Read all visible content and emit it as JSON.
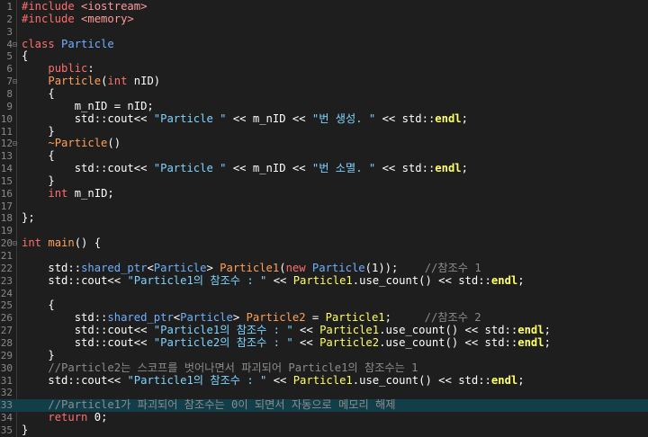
{
  "lines": [
    {
      "n": "1",
      "fold": "",
      "cls": "",
      "tokens": [
        {
          "c": "t-pre",
          "t": "#include "
        },
        {
          "c": "t-inc",
          "t": "<iostream>"
        }
      ]
    },
    {
      "n": "2",
      "fold": "",
      "cls": "",
      "tokens": [
        {
          "c": "t-pre",
          "t": "#include "
        },
        {
          "c": "t-inc",
          "t": "<memory>"
        }
      ]
    },
    {
      "n": "3",
      "fold": "",
      "cls": "",
      "tokens": []
    },
    {
      "n": "4",
      "fold": "⊟",
      "cls": "",
      "tokens": [
        {
          "c": "t-kw",
          "t": "class "
        },
        {
          "c": "t-type",
          "t": "Particle"
        }
      ]
    },
    {
      "n": "5",
      "fold": "",
      "cls": "",
      "tokens": [
        {
          "c": "t-op",
          "t": "{"
        }
      ]
    },
    {
      "n": "6",
      "fold": "",
      "cls": "",
      "tokens": [
        {
          "c": "t-op",
          "t": "    "
        },
        {
          "c": "t-kw",
          "t": "public"
        },
        {
          "c": "t-op",
          "t": ":"
        }
      ]
    },
    {
      "n": "7",
      "fold": "⊟",
      "cls": "",
      "tokens": [
        {
          "c": "t-op",
          "t": "    "
        },
        {
          "c": "t-fn",
          "t": "Particle"
        },
        {
          "c": "t-op",
          "t": "("
        },
        {
          "c": "t-kw",
          "t": "int "
        },
        {
          "c": "t-var",
          "t": "nID"
        },
        {
          "c": "t-op",
          "t": ")"
        }
      ]
    },
    {
      "n": "8",
      "fold": "",
      "cls": "",
      "tokens": [
        {
          "c": "t-op",
          "t": "    {"
        }
      ]
    },
    {
      "n": "9",
      "fold": "",
      "cls": "",
      "tokens": [
        {
          "c": "t-op",
          "t": "        "
        },
        {
          "c": "t-var",
          "t": "m_nID"
        },
        {
          "c": "t-op",
          "t": " = "
        },
        {
          "c": "t-var",
          "t": "nID"
        },
        {
          "c": "t-op",
          "t": ";"
        }
      ]
    },
    {
      "n": "10",
      "fold": "",
      "cls": "",
      "tokens": [
        {
          "c": "t-op",
          "t": "        "
        },
        {
          "c": "t-var",
          "t": "std"
        },
        {
          "c": "t-op",
          "t": "::"
        },
        {
          "c": "t-var",
          "t": "cout"
        },
        {
          "c": "t-op",
          "t": "<< "
        },
        {
          "c": "t-str",
          "t": "\"Particle \""
        },
        {
          "c": "t-op",
          "t": " << "
        },
        {
          "c": "t-var",
          "t": "m_nID"
        },
        {
          "c": "t-op",
          "t": " << "
        },
        {
          "c": "t-str",
          "t": "\"번 생성. \""
        },
        {
          "c": "t-op",
          "t": " << "
        },
        {
          "c": "t-var",
          "t": "std"
        },
        {
          "c": "t-op",
          "t": "::"
        },
        {
          "c": "t-endl",
          "t": "endl"
        },
        {
          "c": "t-op",
          "t": ";"
        }
      ]
    },
    {
      "n": "11",
      "fold": "",
      "cls": "",
      "tokens": [
        {
          "c": "t-op",
          "t": "    }"
        }
      ]
    },
    {
      "n": "12",
      "fold": "⊟",
      "cls": "",
      "tokens": [
        {
          "c": "t-op",
          "t": "    "
        },
        {
          "c": "t-fn",
          "t": "~Particle"
        },
        {
          "c": "t-op",
          "t": "()"
        }
      ]
    },
    {
      "n": "13",
      "fold": "",
      "cls": "",
      "tokens": [
        {
          "c": "t-op",
          "t": "    {"
        }
      ]
    },
    {
      "n": "14",
      "fold": "",
      "cls": "",
      "tokens": [
        {
          "c": "t-op",
          "t": "        "
        },
        {
          "c": "t-var",
          "t": "std"
        },
        {
          "c": "t-op",
          "t": "::"
        },
        {
          "c": "t-var",
          "t": "cout"
        },
        {
          "c": "t-op",
          "t": "<< "
        },
        {
          "c": "t-str",
          "t": "\"Particle \""
        },
        {
          "c": "t-op",
          "t": " << "
        },
        {
          "c": "t-var",
          "t": "m_nID"
        },
        {
          "c": "t-op",
          "t": " << "
        },
        {
          "c": "t-str",
          "t": "\"번 소멸. \""
        },
        {
          "c": "t-op",
          "t": " << "
        },
        {
          "c": "t-var",
          "t": "std"
        },
        {
          "c": "t-op",
          "t": "::"
        },
        {
          "c": "t-endl",
          "t": "endl"
        },
        {
          "c": "t-op",
          "t": ";"
        }
      ]
    },
    {
      "n": "15",
      "fold": "",
      "cls": "",
      "tokens": [
        {
          "c": "t-op",
          "t": "    }"
        }
      ]
    },
    {
      "n": "16",
      "fold": "",
      "cls": "",
      "tokens": [
        {
          "c": "t-op",
          "t": "    "
        },
        {
          "c": "t-kw",
          "t": "int "
        },
        {
          "c": "t-var",
          "t": "m_nID"
        },
        {
          "c": "t-op",
          "t": ";"
        }
      ]
    },
    {
      "n": "17",
      "fold": "",
      "cls": "",
      "tokens": []
    },
    {
      "n": "18",
      "fold": "",
      "cls": "",
      "tokens": [
        {
          "c": "t-op",
          "t": "};"
        }
      ]
    },
    {
      "n": "19",
      "fold": "",
      "cls": "",
      "tokens": []
    },
    {
      "n": "20",
      "fold": "⊟",
      "cls": "",
      "tokens": [
        {
          "c": "t-kw",
          "t": "int "
        },
        {
          "c": "t-fn",
          "t": "main"
        },
        {
          "c": "t-op",
          "t": "() {"
        }
      ]
    },
    {
      "n": "21",
      "fold": "",
      "cls": "",
      "tokens": []
    },
    {
      "n": "22",
      "fold": "",
      "cls": "",
      "tokens": [
        {
          "c": "t-op",
          "t": "    "
        },
        {
          "c": "t-var",
          "t": "std"
        },
        {
          "c": "t-op",
          "t": "::"
        },
        {
          "c": "t-ns",
          "t": "shared_ptr"
        },
        {
          "c": "t-op",
          "t": "<"
        },
        {
          "c": "t-type",
          "t": "Particle"
        },
        {
          "c": "t-op",
          "t": "> "
        },
        {
          "c": "t-fn",
          "t": "Particle1"
        },
        {
          "c": "t-op",
          "t": "("
        },
        {
          "c": "t-kw",
          "t": "new "
        },
        {
          "c": "t-type",
          "t": "Particle"
        },
        {
          "c": "t-op",
          "t": "("
        },
        {
          "c": "t-num",
          "t": "1"
        },
        {
          "c": "t-op",
          "t": "));    "
        },
        {
          "c": "t-cmt",
          "t": "//참조수 1"
        }
      ]
    },
    {
      "n": "23",
      "fold": "",
      "cls": "",
      "tokens": [
        {
          "c": "t-op",
          "t": "    "
        },
        {
          "c": "t-var",
          "t": "std"
        },
        {
          "c": "t-op",
          "t": "::"
        },
        {
          "c": "t-var",
          "t": "cout"
        },
        {
          "c": "t-op",
          "t": "<< "
        },
        {
          "c": "t-str",
          "t": "\"Particle1의 참조수 : \""
        },
        {
          "c": "t-op",
          "t": " << "
        },
        {
          "c": "t-mem",
          "t": "Particle1"
        },
        {
          "c": "t-op",
          "t": "."
        },
        {
          "c": "t-var",
          "t": "use_count"
        },
        {
          "c": "t-op",
          "t": "() << "
        },
        {
          "c": "t-var",
          "t": "std"
        },
        {
          "c": "t-op",
          "t": "::"
        },
        {
          "c": "t-endl",
          "t": "endl"
        },
        {
          "c": "t-op",
          "t": ";"
        }
      ]
    },
    {
      "n": "24",
      "fold": "",
      "cls": "",
      "tokens": []
    },
    {
      "n": "25",
      "fold": "",
      "cls": "",
      "tokens": [
        {
          "c": "t-op",
          "t": "    {"
        }
      ]
    },
    {
      "n": "26",
      "fold": "",
      "cls": "",
      "tokens": [
        {
          "c": "t-op",
          "t": "        "
        },
        {
          "c": "t-var",
          "t": "std"
        },
        {
          "c": "t-op",
          "t": "::"
        },
        {
          "c": "t-ns",
          "t": "shared_ptr"
        },
        {
          "c": "t-op",
          "t": "<"
        },
        {
          "c": "t-type",
          "t": "Particle"
        },
        {
          "c": "t-op",
          "t": "> "
        },
        {
          "c": "t-fn",
          "t": "Particle2"
        },
        {
          "c": "t-op",
          "t": " = "
        },
        {
          "c": "t-mem",
          "t": "Particle1"
        },
        {
          "c": "t-op",
          "t": ";     "
        },
        {
          "c": "t-cmt",
          "t": "//참조수 2"
        }
      ]
    },
    {
      "n": "27",
      "fold": "",
      "cls": "",
      "tokens": [
        {
          "c": "t-op",
          "t": "        "
        },
        {
          "c": "t-var",
          "t": "std"
        },
        {
          "c": "t-op",
          "t": "::"
        },
        {
          "c": "t-var",
          "t": "cout"
        },
        {
          "c": "t-op",
          "t": "<< "
        },
        {
          "c": "t-str",
          "t": "\"Particle1의 참조수 : \""
        },
        {
          "c": "t-op",
          "t": " << "
        },
        {
          "c": "t-mem",
          "t": "Particle1"
        },
        {
          "c": "t-op",
          "t": "."
        },
        {
          "c": "t-var",
          "t": "use_count"
        },
        {
          "c": "t-op",
          "t": "() << "
        },
        {
          "c": "t-var",
          "t": "std"
        },
        {
          "c": "t-op",
          "t": "::"
        },
        {
          "c": "t-endl",
          "t": "endl"
        },
        {
          "c": "t-op",
          "t": ";"
        }
      ]
    },
    {
      "n": "28",
      "fold": "",
      "cls": "",
      "tokens": [
        {
          "c": "t-op",
          "t": "        "
        },
        {
          "c": "t-var",
          "t": "std"
        },
        {
          "c": "t-op",
          "t": "::"
        },
        {
          "c": "t-var",
          "t": "cout"
        },
        {
          "c": "t-op",
          "t": "<< "
        },
        {
          "c": "t-str",
          "t": "\"Particle2의 참조수 : \""
        },
        {
          "c": "t-op",
          "t": " << "
        },
        {
          "c": "t-mem",
          "t": "Particle2"
        },
        {
          "c": "t-op",
          "t": "."
        },
        {
          "c": "t-var",
          "t": "use_count"
        },
        {
          "c": "t-op",
          "t": "() << "
        },
        {
          "c": "t-var",
          "t": "std"
        },
        {
          "c": "t-op",
          "t": "::"
        },
        {
          "c": "t-endl",
          "t": "endl"
        },
        {
          "c": "t-op",
          "t": ";"
        }
      ]
    },
    {
      "n": "29",
      "fold": "",
      "cls": "",
      "tokens": [
        {
          "c": "t-op",
          "t": "    }"
        }
      ]
    },
    {
      "n": "30",
      "fold": "",
      "cls": "",
      "tokens": [
        {
          "c": "t-op",
          "t": "    "
        },
        {
          "c": "t-cmt",
          "t": "//Particle2는 스코프를 벗어나면서 파괴되어 Particle1의 참조수는 1"
        }
      ]
    },
    {
      "n": "31",
      "fold": "",
      "cls": "",
      "tokens": [
        {
          "c": "t-op",
          "t": "    "
        },
        {
          "c": "t-var",
          "t": "std"
        },
        {
          "c": "t-op",
          "t": "::"
        },
        {
          "c": "t-var",
          "t": "cout"
        },
        {
          "c": "t-op",
          "t": "<< "
        },
        {
          "c": "t-str",
          "t": "\"Particle1의 참조수 : \""
        },
        {
          "c": "t-op",
          "t": " << "
        },
        {
          "c": "t-mem",
          "t": "Particle1"
        },
        {
          "c": "t-op",
          "t": "."
        },
        {
          "c": "t-var",
          "t": "use_count"
        },
        {
          "c": "t-op",
          "t": "() << "
        },
        {
          "c": "t-var",
          "t": "std"
        },
        {
          "c": "t-op",
          "t": "::"
        },
        {
          "c": "t-endl",
          "t": "endl"
        },
        {
          "c": "t-op",
          "t": ";"
        }
      ]
    },
    {
      "n": "32",
      "fold": "",
      "cls": "",
      "tokens": []
    },
    {
      "n": "33",
      "fold": "",
      "cls": "current",
      "tokens": [
        {
          "c": "t-op",
          "t": "    "
        },
        {
          "c": "t-cmt",
          "t": "//Particle1가 파괴되어 참조수는 0이 되면서 자동으로 메모리 해제"
        }
      ]
    },
    {
      "n": "34",
      "fold": "",
      "cls": "",
      "tokens": [
        {
          "c": "t-op",
          "t": "    "
        },
        {
          "c": "t-kw",
          "t": "return "
        },
        {
          "c": "t-num",
          "t": "0"
        },
        {
          "c": "t-op",
          "t": ";"
        }
      ]
    },
    {
      "n": "35",
      "fold": "",
      "cls": "",
      "tokens": [
        {
          "c": "t-op",
          "t": "}"
        }
      ]
    }
  ]
}
